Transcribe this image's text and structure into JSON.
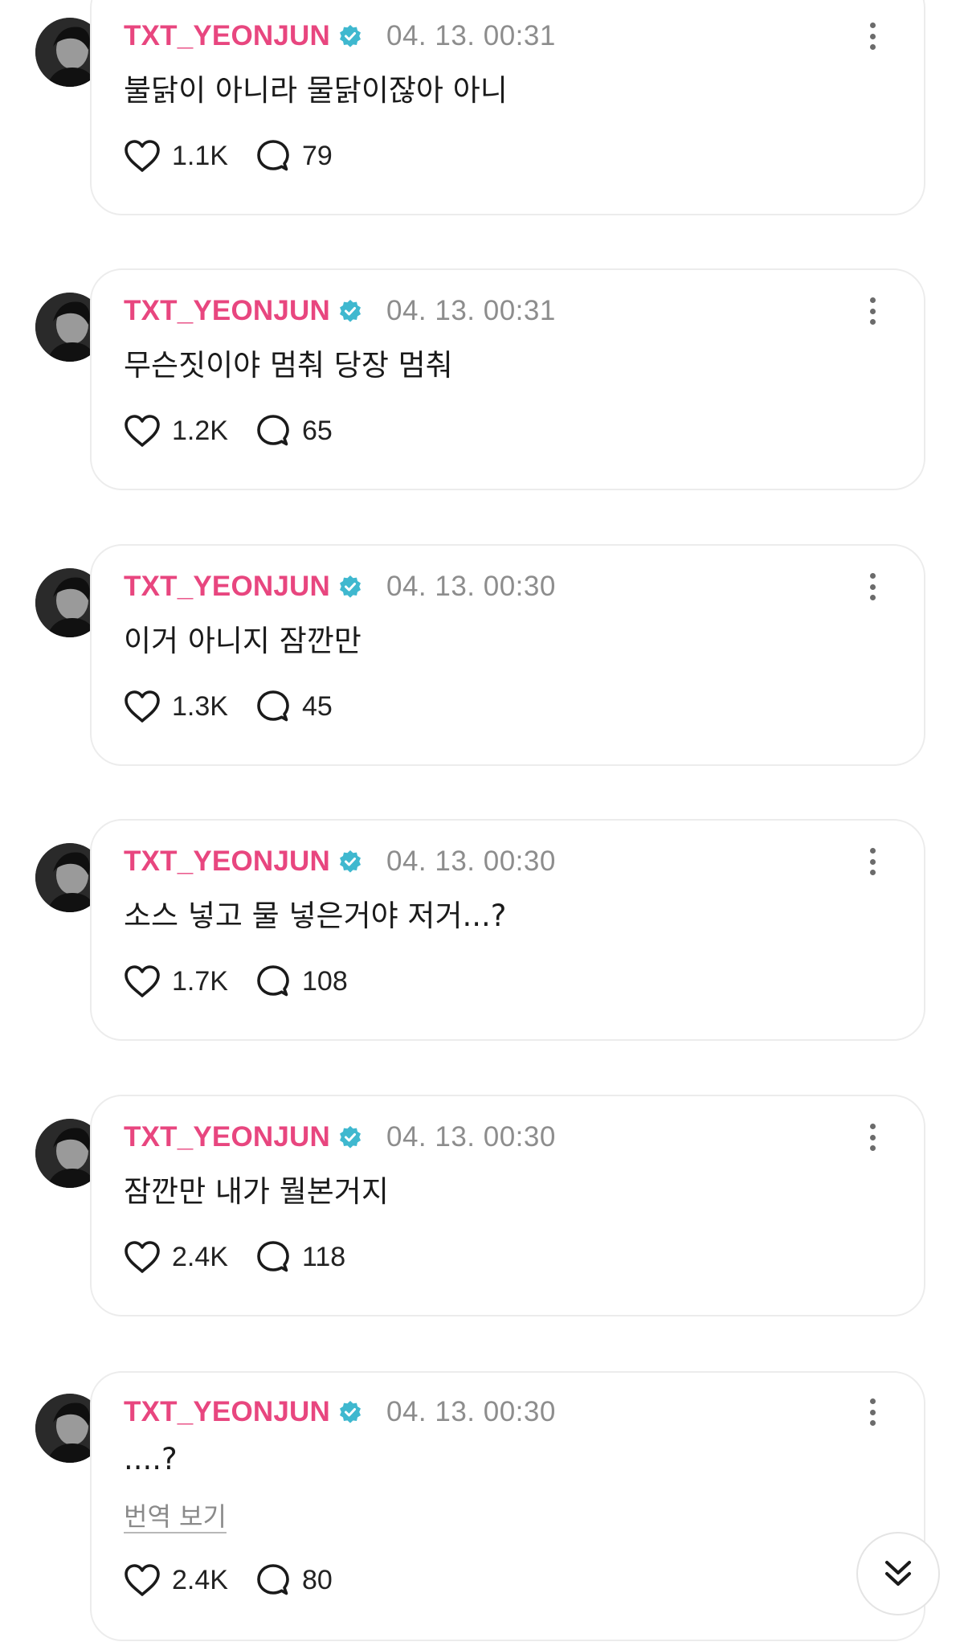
{
  "colors": {
    "username": "#e8467f",
    "verified_badge": "#3fb8cf",
    "timestamp": "#8d8d8d",
    "card_border": "#ececec",
    "text": "#1a1a1a"
  },
  "posts": [
    {
      "username": "TXT_YEONJUN",
      "verified_icon": "verified-badge-icon",
      "timestamp": "04. 13. 00:31",
      "text": "불닭이 아니라 물닭이잖아 아니",
      "likes": "1.1K",
      "comments": "79"
    },
    {
      "username": "TXT_YEONJUN",
      "verified_icon": "verified-badge-icon",
      "timestamp": "04. 13. 00:31",
      "text": "무슨짓이야 멈춰 당장 멈춰",
      "likes": "1.2K",
      "comments": "65"
    },
    {
      "username": "TXT_YEONJUN",
      "verified_icon": "verified-badge-icon",
      "timestamp": "04. 13. 00:30",
      "text": "이거 아니지 잠깐만",
      "likes": "1.3K",
      "comments": "45"
    },
    {
      "username": "TXT_YEONJUN",
      "verified_icon": "verified-badge-icon",
      "timestamp": "04. 13. 00:30",
      "text": "소스 넣고 물 넣은거야 저거...?",
      "likes": "1.7K",
      "comments": "108"
    },
    {
      "username": "TXT_YEONJUN",
      "verified_icon": "verified-badge-icon",
      "timestamp": "04. 13. 00:30",
      "text": "잠깐만 내가 뭘본거지",
      "likes": "2.4K",
      "comments": "118"
    },
    {
      "username": "TXT_YEONJUN",
      "verified_icon": "verified-badge-icon",
      "timestamp": "04. 13. 00:30",
      "text": "....?",
      "translate_label": "번역 보기",
      "likes": "2.4K",
      "comments": "80"
    }
  ],
  "scroll_button_icon": "double-chevron-down-icon"
}
